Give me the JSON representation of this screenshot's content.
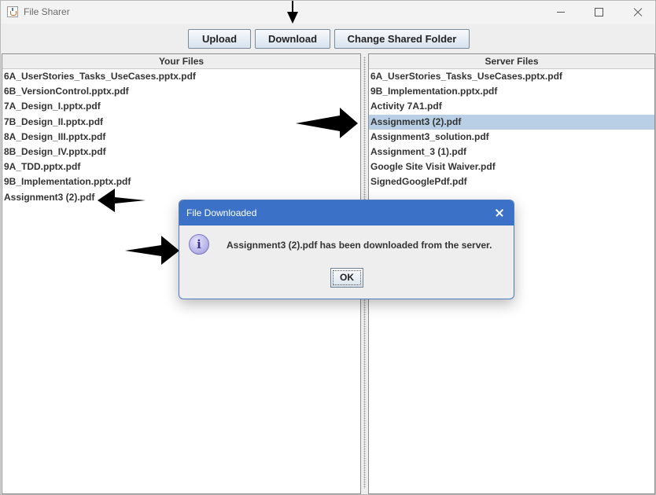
{
  "window": {
    "title": "File Sharer",
    "controls": {
      "minimize": "minimize-icon",
      "maximize": "maximize-icon",
      "close": "close-icon"
    }
  },
  "toolbar": {
    "upload_label": "Upload",
    "download_label": "Download",
    "change_folder_label": "Change Shared Folder"
  },
  "your_files": {
    "header": "Your Files",
    "items": [
      "6A_UserStories_Tasks_UseCases.pptx.pdf",
      "6B_VersionControl.pptx.pdf",
      "7A_Design_I.pptx.pdf",
      "7B_Design_II.pptx.pdf",
      "8A_Design_III.pptx.pdf",
      "8B_Design_IV.pptx.pdf",
      "9A_TDD.pptx.pdf",
      "9B_Implementation.pptx.pdf",
      "Assignment3 (2).pdf"
    ]
  },
  "server_files": {
    "header": "Server Files",
    "selected_index": 3,
    "items": [
      "6A_UserStories_Tasks_UseCases.pptx.pdf",
      "9B_Implementation.pptx.pdf",
      "Activity 7A1.pdf",
      "Assignment3 (2).pdf",
      "Assignment3_solution.pdf",
      "Assignment_3 (1).pdf",
      "Google Site Visit Waiver.pdf",
      "SignedGooglePdf.pdf"
    ]
  },
  "dialog": {
    "title": "File Downloaded",
    "message": "Assignment3 (2).pdf has been downloaded from the server.",
    "ok_label": "OK",
    "icon": "info-icon"
  },
  "colors": {
    "selection": "#b8cfe5",
    "dialog_titlebar": "#3b72c7",
    "window_bg": "#eeeeee"
  }
}
